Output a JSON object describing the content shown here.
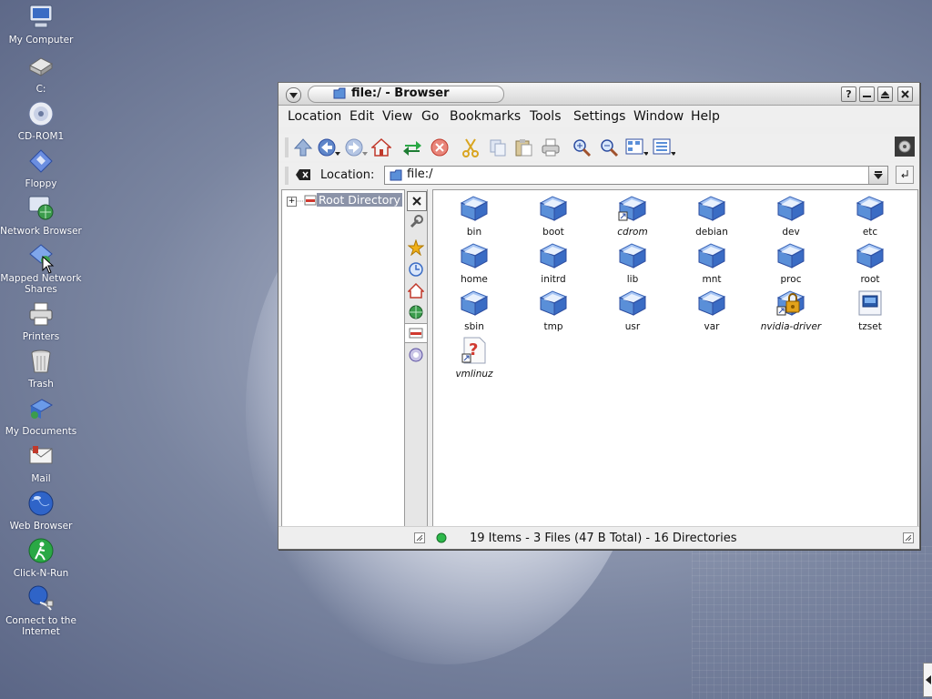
{
  "desktop": {
    "icons": [
      {
        "label": "My Computer"
      },
      {
        "label": "C:"
      },
      {
        "label": "CD-ROM1"
      },
      {
        "label": "Floppy"
      },
      {
        "label": "Network Browser"
      },
      {
        "label": "Mapped Network Shares"
      },
      {
        "label": "Printers"
      },
      {
        "label": "Trash"
      },
      {
        "label": "My Documents"
      },
      {
        "label": "Mail"
      },
      {
        "label": "Web Browser"
      },
      {
        "label": "Click-N-Run"
      },
      {
        "label": "Connect to the Internet"
      }
    ]
  },
  "window": {
    "title": "file:/ - Browser",
    "menu": [
      "Location",
      "Edit",
      "View",
      "Go",
      "Bookmarks",
      "Tools",
      "Settings",
      "Window",
      "Help"
    ],
    "toolbar_icons": [
      "up-arrow",
      "back-arrow",
      "forward-arrow",
      "home",
      "reload",
      "stop",
      "cut",
      "copy",
      "paste",
      "print",
      "zoom-in",
      "zoom-out",
      "icon-view",
      "detail-view"
    ],
    "location_label": "Location:",
    "location_value": "file:/",
    "tree": {
      "root_label": "Root Directory"
    },
    "files": [
      {
        "name": "bin",
        "type": "folder"
      },
      {
        "name": "boot",
        "type": "folder"
      },
      {
        "name": "cdrom",
        "type": "folder-link"
      },
      {
        "name": "debian",
        "type": "folder"
      },
      {
        "name": "dev",
        "type": "folder"
      },
      {
        "name": "etc",
        "type": "folder"
      },
      {
        "name": "home",
        "type": "folder"
      },
      {
        "name": "initrd",
        "type": "folder"
      },
      {
        "name": "lib",
        "type": "folder"
      },
      {
        "name": "mnt",
        "type": "folder"
      },
      {
        "name": "proc",
        "type": "folder"
      },
      {
        "name": "root",
        "type": "folder"
      },
      {
        "name": "sbin",
        "type": "folder"
      },
      {
        "name": "tmp",
        "type": "folder"
      },
      {
        "name": "usr",
        "type": "folder"
      },
      {
        "name": "var",
        "type": "folder"
      },
      {
        "name": "nvidia-driver",
        "type": "locked-folder-link"
      },
      {
        "name": "tzset",
        "type": "executable"
      },
      {
        "name": "vmlinuz",
        "type": "unknown-link"
      }
    ],
    "status": "19 Items - 3 Files (47 B Total) - 16 Directories"
  },
  "colors": {
    "folder_blue": "#5a8fd8",
    "selection": "#8b93a8",
    "status_led": "#2db84a"
  }
}
